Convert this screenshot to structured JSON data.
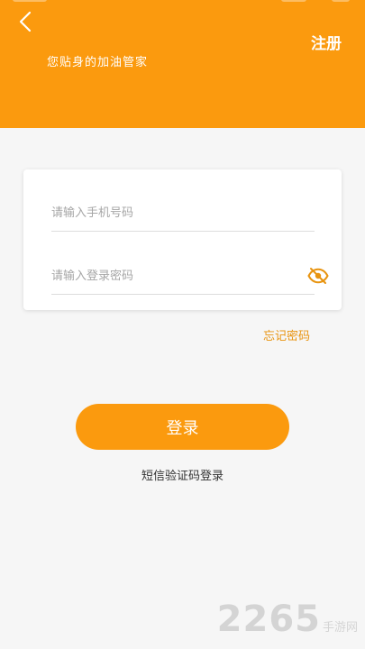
{
  "header": {
    "subtitle": "您贴身的加油管家",
    "register_label": "注册",
    "background_color": "#fb9a0e"
  },
  "form": {
    "phone_placeholder": "请输入手机号码",
    "password_placeholder": "请输入登录密码",
    "password_visibility_icon": "eye-off-icon"
  },
  "links": {
    "forgot_password": "忘记密码",
    "sms_login": "短信验证码登录"
  },
  "login_button": {
    "label": "登录"
  },
  "colors": {
    "accent": "#fb9a0e",
    "link": "#e89410"
  },
  "watermark": {
    "number": "2265",
    "suffix": "手游网"
  }
}
